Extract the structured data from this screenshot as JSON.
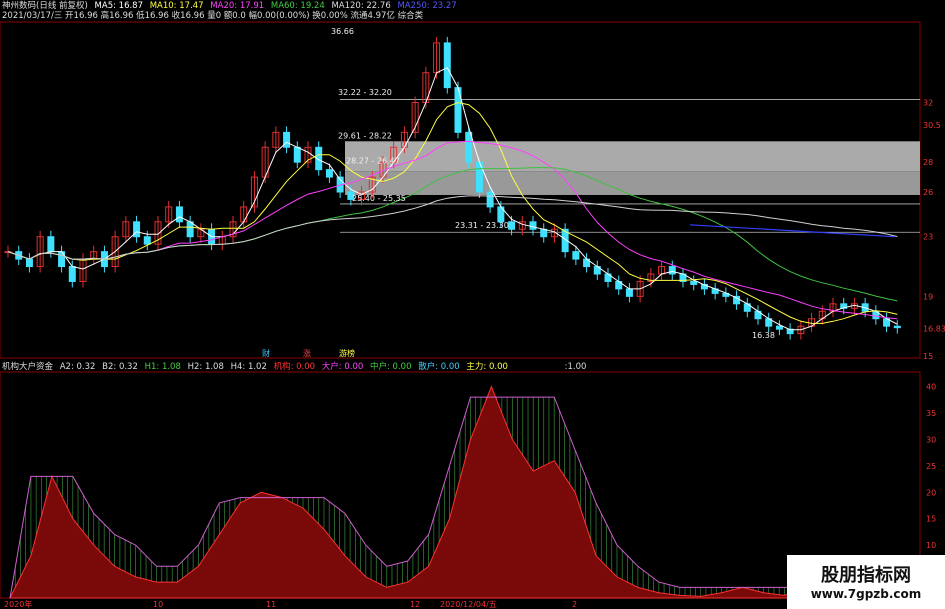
{
  "colors": {
    "up": "#e03030",
    "down": "#40e0ff",
    "ma5": "#ffffff",
    "ma10": "#ffff40",
    "ma20": "#ff40ff",
    "ma60": "#40c040",
    "ma120": "#d0d0d0",
    "ma250": "#3040ff"
  },
  "main": {
    "title": "神州数码(日线 前复权)",
    "ma_labels": [
      "MA5: 16.87",
      "MA10: 17.47",
      "MA20: 17.91",
      "MA60: 19.24",
      "MA120: 22.76",
      "MA250: 23.27"
    ],
    "info_line": "2021/03/17/三 开16.96 高16.96 低16.96 收16.96 量0 额0.0 幅0.00(0.00%) 换0.00% 流通4.97亿 综合类",
    "axis_labels": [
      "32",
      "30.5",
      "28",
      "26",
      "23",
      "19",
      "16.83",
      "15"
    ],
    "annotations": [
      "36.66",
      "32.22 - 32.20",
      "29.61 - 28.22",
      "28.27 - 26.47",
      "25.40 - 25.35",
      "23.31 - 23.30",
      "16.38"
    ],
    "event_labels": [
      "财",
      "涨",
      "游榜"
    ]
  },
  "sub": {
    "title": "机构大户资金",
    "labels": [
      "A2: 0.32",
      "B2: 0.32",
      "H1: 1.08",
      "H2: 1.08",
      "H4: 1.02"
    ],
    "fund_labels": [
      "机构: 0.00",
      "大户: 0.00",
      "中户: 0.00",
      "散户: 0.00",
      "主力: 0.00"
    ],
    "extra": ":1.00",
    "axis_labels": [
      "40",
      "35",
      "30",
      "25",
      "20",
      "15",
      "10",
      "5"
    ],
    "x_labels": [
      "2020年",
      "10",
      "11",
      "12",
      "2020/12/04/五",
      "2"
    ]
  },
  "watermark": {
    "line1": "股朋指标网",
    "line2": "www.7gpzb.com"
  },
  "chart_data": [
    {
      "type": "candlestick",
      "title": "神州数码(日线 前复权)",
      "ylim": [
        15,
        37
      ],
      "annotations": [
        "36.66",
        "16.38"
      ],
      "series": [
        {
          "name": "MA5"
        },
        {
          "name": "MA10"
        },
        {
          "name": "MA20"
        },
        {
          "name": "MA60"
        },
        {
          "name": "MA120"
        },
        {
          "name": "MA250"
        }
      ],
      "close": [
        22,
        21.5,
        21,
        23,
        22,
        21,
        20,
        21.5,
        22,
        21,
        23,
        24,
        23,
        22.5,
        24,
        25,
        24,
        23,
        23.5,
        22.5,
        23,
        24,
        25,
        27,
        29,
        30,
        29,
        28,
        29,
        27.5,
        27,
        26,
        25.5,
        26,
        27,
        28,
        29,
        30,
        32,
        34,
        36,
        33,
        30,
        28,
        26,
        25,
        24,
        23.5,
        24,
        23.5,
        23,
        23.5,
        22,
        21.5,
        21,
        20.5,
        20,
        19.5,
        19,
        20,
        20.5,
        21,
        20.5,
        20,
        19.8,
        19.5,
        19.2,
        19,
        18.5,
        18,
        17.5,
        17,
        16.8,
        16.5,
        17,
        17.5,
        18,
        18.5,
        18.2,
        18.5,
        18,
        17.5,
        17,
        16.9
      ]
    },
    {
      "type": "area",
      "title": "机构大户资金",
      "ylim": [
        0,
        42
      ],
      "series": [
        {
          "name": "机构",
          "values": [
            0,
            8,
            23,
            15,
            10,
            6,
            4,
            3,
            3,
            6,
            12,
            18,
            20,
            19,
            17,
            13,
            8,
            4,
            2,
            3,
            6,
            15,
            30,
            40,
            30,
            24,
            26,
            20,
            8,
            4,
            2,
            1,
            0.5,
            0.3,
            1,
            2,
            1,
            0.5,
            2,
            1,
            0.5,
            0.3,
            0.2,
            0.2
          ]
        },
        {
          "name": "大户",
          "values": [
            0,
            23,
            23,
            23,
            16,
            12,
            10,
            6,
            6,
            10,
            18,
            19,
            19,
            19,
            19,
            19,
            16,
            10,
            6,
            7,
            12,
            25,
            38,
            38,
            38,
            38,
            38,
            28,
            18,
            10,
            6,
            3,
            2,
            2,
            2,
            2,
            2,
            2,
            2,
            2,
            1,
            1,
            1,
            1
          ]
        }
      ]
    }
  ]
}
